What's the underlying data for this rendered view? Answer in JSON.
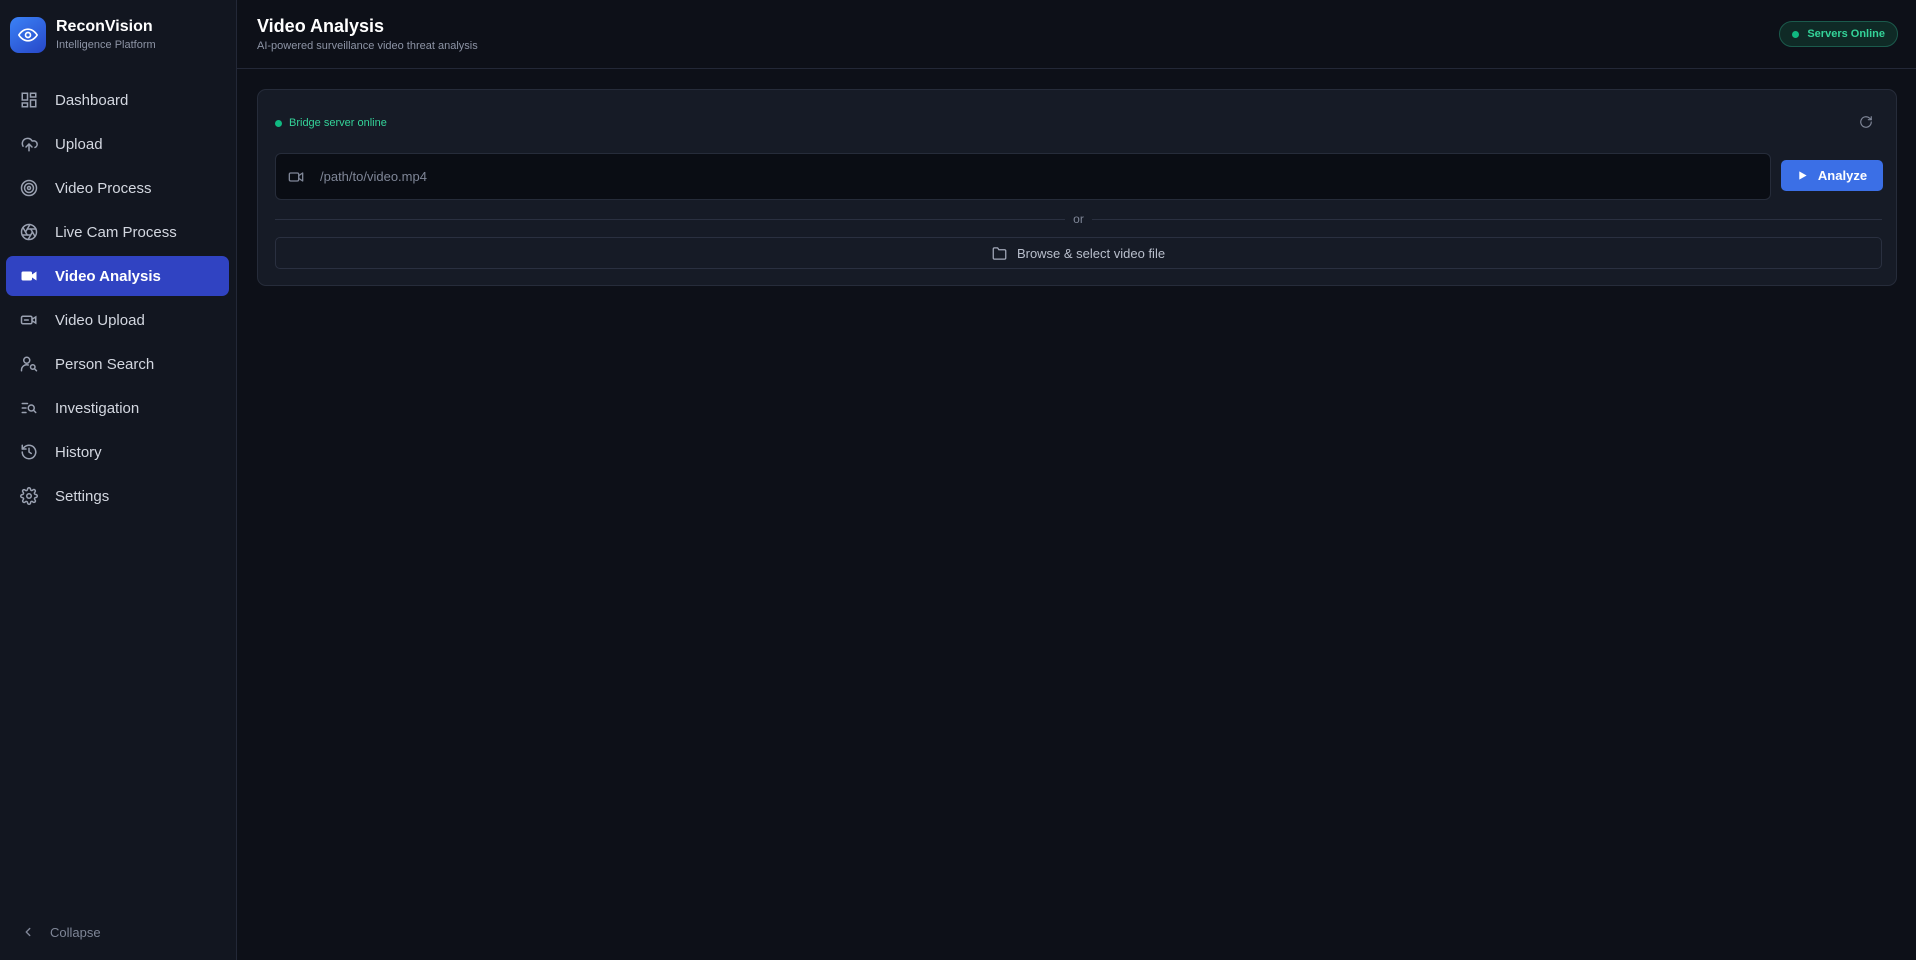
{
  "brand": {
    "title": "ReconVision",
    "subtitle": "Intelligence Platform",
    "logo_icon": "eye-icon"
  },
  "sidebar": {
    "items": [
      {
        "label": "Dashboard",
        "icon": "dashboard-icon",
        "active": false
      },
      {
        "label": "Upload",
        "icon": "cloud-upload-icon",
        "active": false
      },
      {
        "label": "Video Process",
        "icon": "target-icon",
        "active": false
      },
      {
        "label": "Live Cam Process",
        "icon": "aperture-icon",
        "active": false
      },
      {
        "label": "Video Analysis",
        "icon": "video-camera-icon",
        "active": true
      },
      {
        "label": "Video Upload",
        "icon": "video-upload-icon",
        "active": false
      },
      {
        "label": "Person Search",
        "icon": "person-search-icon",
        "active": false
      },
      {
        "label": "Investigation",
        "icon": "list-search-icon",
        "active": false
      },
      {
        "label": "History",
        "icon": "history-icon",
        "active": false
      },
      {
        "label": "Settings",
        "icon": "gear-icon",
        "active": false
      }
    ],
    "collapse_label": "Collapse"
  },
  "header": {
    "title": "Video Analysis",
    "subtitle": "AI-powered surveillance video threat analysis",
    "status": "Servers Online"
  },
  "panel": {
    "bridge_status": "Bridge server online",
    "path_placeholder": "/path/to/video.mp4",
    "path_value": "",
    "analyze_label": "Analyze",
    "divider_text": "or",
    "browse_label": "Browse & select video file"
  },
  "colors": {
    "accent": "#3043c2",
    "button": "#3b6fe6",
    "online": "#10b981",
    "background": "#0d1018",
    "sidebar": "#121620"
  }
}
